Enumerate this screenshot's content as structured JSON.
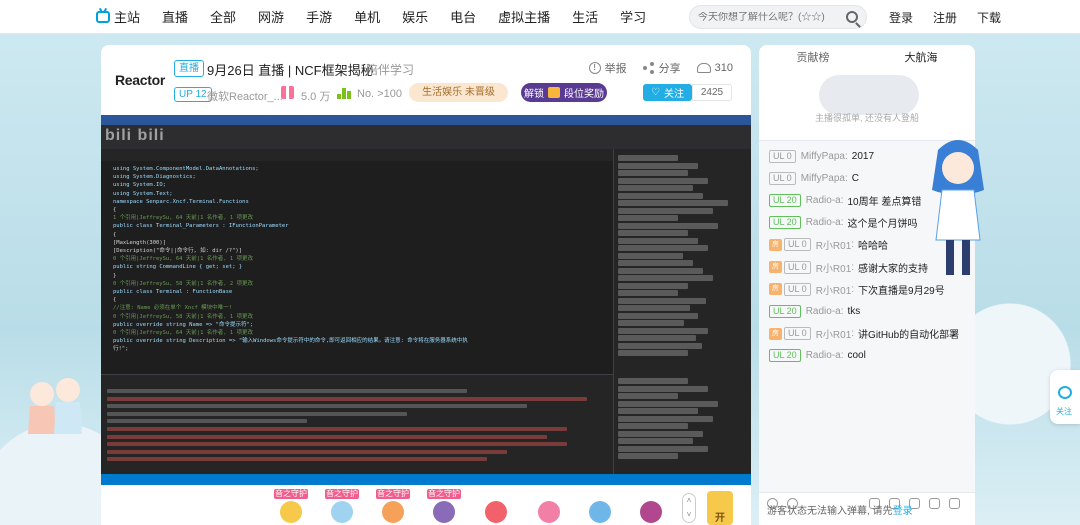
{
  "nav": {
    "home": "主站",
    "items": [
      "直播",
      "全部",
      "网游",
      "手游",
      "单机",
      "娱乐",
      "电台",
      "虚拟主播",
      "生活",
      "学习"
    ],
    "search_placeholder": "今天你想了解什么呢？(☆☆)",
    "login": "登录",
    "register": "注册",
    "download": "下载"
  },
  "room": {
    "logo": "Reactor",
    "live_tag": "直播",
    "title": "9月26日 直播 | NCF框架揭秘",
    "area": "陪伴学习",
    "report": "举报",
    "share": "分享",
    "viewers": "310",
    "up_badge": "UP 12",
    "up_name": "微软Reactor_...",
    "fans": "5.0 万",
    "rank": "No. >100",
    "area_rank": "生活娱乐 未晋级",
    "unlock": "解锁",
    "unlock_reward": "段位奖励",
    "follow": "关注",
    "follow_count": "2425"
  },
  "video": {
    "watermark": "bili bili"
  },
  "code_lines": [
    "using System.ComponentModel.DataAnnotations;",
    "using System.Diagnostics;",
    "using System.IO;",
    "using System.Text;",
    "",
    "namespace Senparc.Xncf.Terminal.Functions",
    "{",
    "    1 个引用|JeffreySu, 64 天前|1 名作者, 1 项更改",
    "    public class Terminal_Parameters : IFunctionParameter",
    "    {",
    "        [MaxLength(300)]",
    "        [Description(\"命令||命令行, 如: dir /?\")]",
    "        0 个引用|JeffreySu, 64 天前|1 名作者, 1 项更改",
    "        public string CommandLine { get; set; }",
    "    }",
    "",
    "    0 个引用|JeffreySu, 58 天前|1 名作者, 2 项更改",
    "    public class Terminal : FunctionBase",
    "    {",
    "        //注意: Name 必须在单个 Xncf 模块中唯一!",
    "        0 个引用|JeffreySu, 58 天前|1 名作者, 1 项更改",
    "        public override string Name => \"命令提示符\";",
    "",
    "        0 个引用|JeffreySu, 64 天前|1 名作者, 1 项更改",
    "        public override string Description => \"输入Windows命令提示符中的命令,即可返回相应的结果。请注意: 命令将在服务器系统中执",
    "            行!\";"
  ],
  "gifts": [
    {
      "label": "音之守护",
      "color": "#f7c94a"
    },
    {
      "label": "音之守护",
      "color": "#9fd3f0"
    },
    {
      "label": "音之守护",
      "color": "#f5a15a"
    },
    {
      "label": "音之守护",
      "color": "#8a6bb8"
    },
    {
      "label": "",
      "color": "#f2626a"
    },
    {
      "label": "",
      "color": "#f27fa6"
    },
    {
      "label": "",
      "color": "#6fb7e8"
    },
    {
      "label": "",
      "color": "#b0478f"
    }
  ],
  "gift_open": "开",
  "side": {
    "tab_contrib": "贡献榜",
    "tab_captain": "大航海",
    "rank_tip": "主播很孤单, 还没有人登船",
    "danmaku": [
      {
        "room": "",
        "level": "UL 0",
        "lv": "gray",
        "user": "MiffyPapa",
        "text": "2017"
      },
      {
        "room": "",
        "level": "UL 0",
        "lv": "gray",
        "user": "MiffyPapa",
        "text": "C"
      },
      {
        "room": "",
        "level": "UL 20",
        "lv": "green",
        "user": "Radio-a",
        "text": "10周年 差点算错"
      },
      {
        "room": "",
        "level": "UL 20",
        "lv": "green",
        "user": "Radio-a",
        "text": "这个是个月饼吗"
      },
      {
        "room": "房",
        "level": "UL 0",
        "lv": "gray",
        "user": "R小R01",
        "text": "哈哈哈"
      },
      {
        "room": "房",
        "level": "UL 0",
        "lv": "gray",
        "user": "R小R01",
        "text": "感谢大家的支持"
      },
      {
        "room": "房",
        "level": "UL 0",
        "lv": "gray",
        "user": "R小R01",
        "text": "下次直播是9月29号"
      },
      {
        "room": "",
        "level": "UL 20",
        "lv": "green",
        "user": "Radio-a",
        "text": "tks"
      },
      {
        "room": "房",
        "level": "UL 0",
        "lv": "gray",
        "user": "R小R01",
        "text": "讲GitHub的自动化部署"
      },
      {
        "room": "",
        "level": "UL 20",
        "lv": "green",
        "user": "Radio-a",
        "text": "cool"
      }
    ],
    "input_hint": "游客状态无法输入弹幕, 请先",
    "input_login": "登录"
  },
  "float_follow": "关注"
}
